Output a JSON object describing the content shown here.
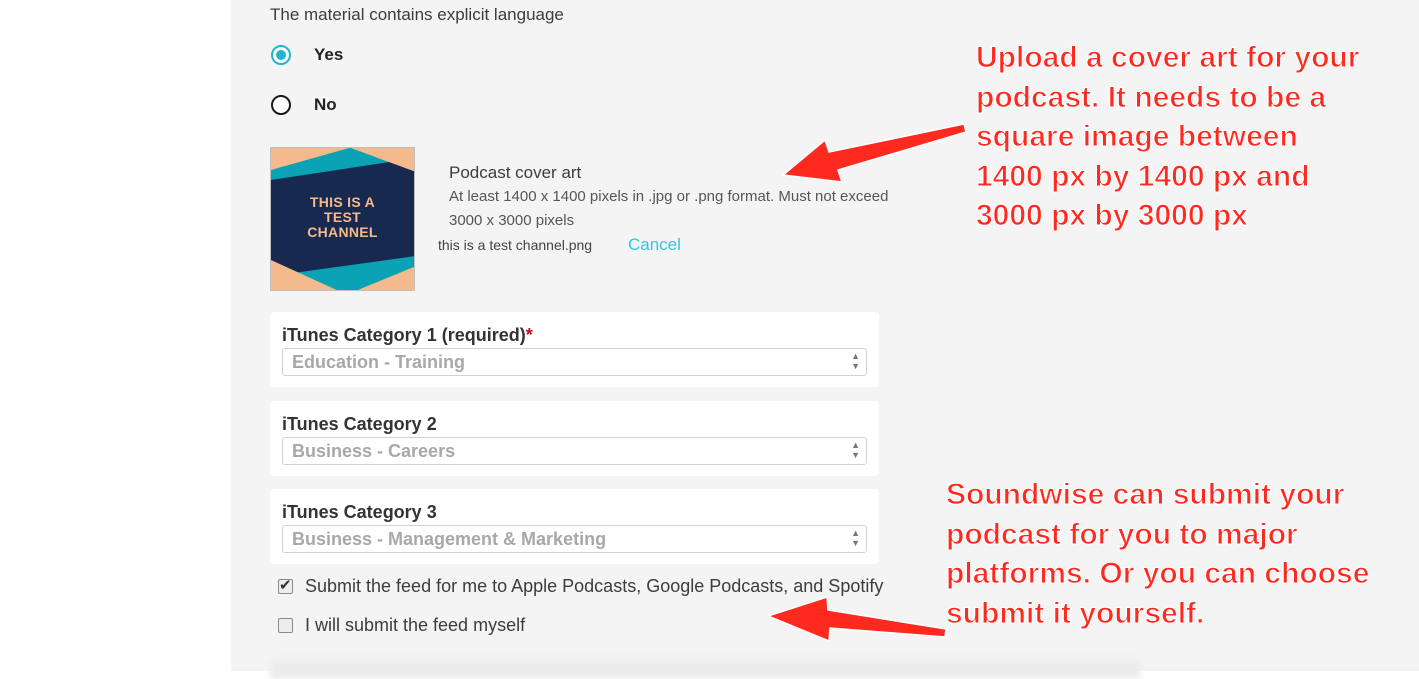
{
  "explicit": {
    "question": "The material contains explicit language",
    "options": [
      {
        "label": "Yes",
        "selected": true
      },
      {
        "label": "No",
        "selected": false
      }
    ]
  },
  "cover_art": {
    "image_text": [
      "THIS IS A",
      "TEST",
      "CHANNEL"
    ],
    "title": "Podcast cover art",
    "description": "At least 1400 x 1400 pixels in .jpg or .png format. Must not exceed 3000 x 3000 pixels",
    "filename": "this is a test channel.png",
    "cancel_label": "Cancel"
  },
  "categories": [
    {
      "label": "iTunes Category 1 (required)",
      "required": true,
      "value": "Education - Training"
    },
    {
      "label": "iTunes Category 2",
      "required": false,
      "value": "Business - Careers"
    },
    {
      "label": "iTunes Category 3",
      "required": false,
      "value": "Business - Management & Marketing"
    }
  ],
  "submit_options": [
    {
      "label": "Submit the feed for me to Apple Podcasts, Google Podcasts, and Spotify",
      "checked": true
    },
    {
      "label": "I will submit the feed myself",
      "checked": false
    }
  ],
  "annotations": {
    "cover_art_note": [
      "Upload a cover art for your",
      "podcast. It needs to be a",
      "square image between",
      "1400 px by 1400 px and",
      "3000 px by 3000 px"
    ],
    "submit_note": [
      "Soundwise can submit your",
      "podcast for you to major",
      "platforms. Or you can choose",
      "submit it yourself."
    ]
  },
  "colors": {
    "accent": "#1fb6cc",
    "link": "#2ec8e0",
    "annotation": "#ff2a1f",
    "required": "#d0021b",
    "cover_navy": "#17294e",
    "cover_teal": "#0aa3b5",
    "cover_peach": "#f4b98c"
  }
}
